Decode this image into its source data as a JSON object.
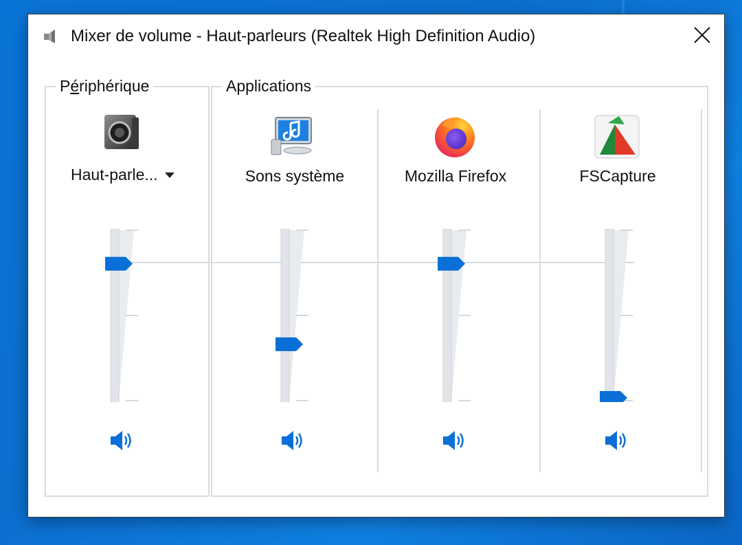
{
  "window": {
    "title": "Mixer de volume - Haut-parleurs (Realtek High Definition Audio)",
    "title_icon": "speaker-icon",
    "close_icon": "close-icon"
  },
  "device": {
    "group_label_prefix": "P",
    "group_label_hotkey": "é",
    "group_label_suffix": "riphérique",
    "name": "Haut-parle...",
    "icon": "speaker-device-icon",
    "volume_percent": 80,
    "mute_icon": "speaker-volume-icon"
  },
  "applications": {
    "group_label": "Applications",
    "items": [
      {
        "name": "Sons système",
        "icon": "system-sounds-icon",
        "volume_percent": 32,
        "mute_icon": "speaker-volume-icon"
      },
      {
        "name": "Mozilla Firefox",
        "icon": "firefox-icon",
        "volume_percent": 80,
        "mute_icon": "speaker-volume-icon"
      },
      {
        "name": "FSCapture",
        "icon": "fscapture-icon",
        "volume_percent": 0,
        "mute_icon": "speaker-volume-icon"
      }
    ]
  },
  "colors": {
    "accent": "#0a6fd6",
    "desktop": "#0a74d6"
  }
}
